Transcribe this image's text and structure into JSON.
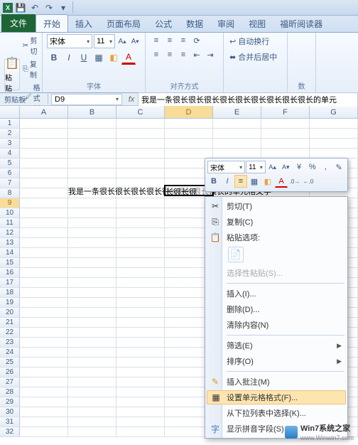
{
  "titlebar": {
    "app_icon": "X",
    "qat": {
      "save": "💾",
      "undo": "↶",
      "redo": "↷",
      "dd": "▾"
    }
  },
  "tabs": {
    "file": "文件",
    "home": "开始",
    "insert": "插入",
    "pagelayout": "页面布局",
    "formulas": "公式",
    "data": "数据",
    "review": "审阅",
    "view": "视图",
    "foxit": "福昕阅读器"
  },
  "ribbon": {
    "clipboard": {
      "paste": "粘贴",
      "cut": "剪切",
      "copy": "复制",
      "format_painter": "格式刷",
      "title": "剪贴板"
    },
    "font": {
      "name": "宋体",
      "size": "11",
      "grow": "A▴",
      "bold": "B",
      "italic": "I",
      "underline": "U",
      "border": "▦",
      "fill": "◧",
      "color": "A",
      "title": "字体"
    },
    "align": {
      "wrap_text": "自动换行",
      "merge": "合并后居中",
      "title": "对齐方式"
    },
    "number": {
      "title": "数"
    }
  },
  "fbar": {
    "cliplabel": "剪贴板",
    "name_box": "D9",
    "fx": "fx",
    "formula": "我是一条很长很长很长很长很长很长很长很长很长的单元"
  },
  "grid": {
    "cols": [
      "A",
      "B",
      "C",
      "D",
      "E",
      "F",
      "G"
    ],
    "sel_col_idx": 3,
    "row_count": 32,
    "sel_row": 9,
    "long_text": "我是一条很长很长很长很长很长很长很长很长的单元格文字",
    "sel_text_frag": "长很长很"
  },
  "mini": {
    "font": "宋体",
    "size": "11",
    "grow": "A▴",
    "shrink": "A▾",
    "currency": "¥",
    "percent": "%",
    "comma": ",",
    "bold": "B",
    "italic": "I",
    "border": "▦",
    "fill": "◧",
    "color": "A",
    "dec_inc": ".0→",
    "dec_dec": "←.0",
    "fp": "✎"
  },
  "context": {
    "cut": "剪切(T)",
    "copy": "复制(C)",
    "paste_options": "粘贴选项:",
    "paste_special": "选择性粘贴(S)...",
    "insert": "插入(I)...",
    "delete": "删除(D)...",
    "clear": "清除内容(N)",
    "filter": "筛选(E)",
    "sort": "排序(O)",
    "insert_comment": "插入批注(M)",
    "format_cells": "设置单元格格式(F)...",
    "pick_list": "从下拉列表中选择(K)...",
    "phonetic": "显示拼音字段(S)"
  },
  "watermark": {
    "main": "Win7系统之家",
    "sub": "www.Winwin7.com"
  }
}
